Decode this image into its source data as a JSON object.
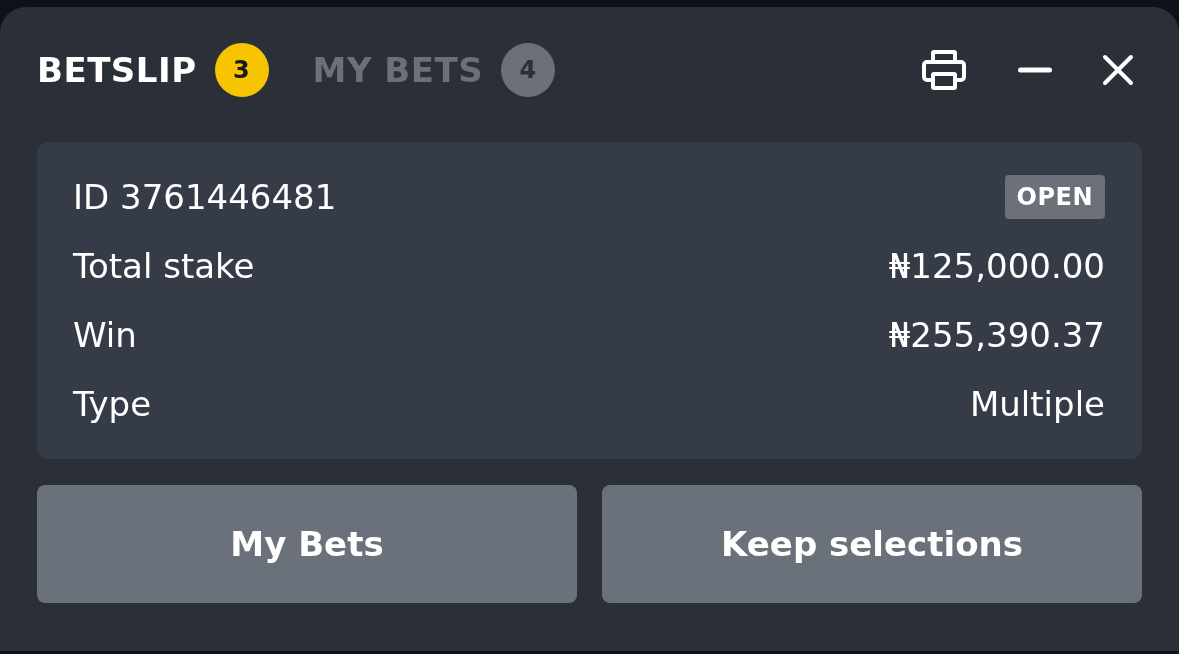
{
  "tabs": [
    {
      "label": "BETSLIP",
      "count": "3",
      "selected": true
    },
    {
      "label": "MY BETS",
      "count": "4",
      "selected": false
    }
  ],
  "bet": {
    "id": "ID 3761446481",
    "status": "OPEN",
    "rows": [
      {
        "label": "Total stake",
        "value": "₦125,000.00"
      },
      {
        "label": "Win",
        "value": "₦255,390.37"
      },
      {
        "label": "Type",
        "value": "Multiple"
      }
    ]
  },
  "buttons": [
    "My Bets",
    "Keep selections"
  ]
}
